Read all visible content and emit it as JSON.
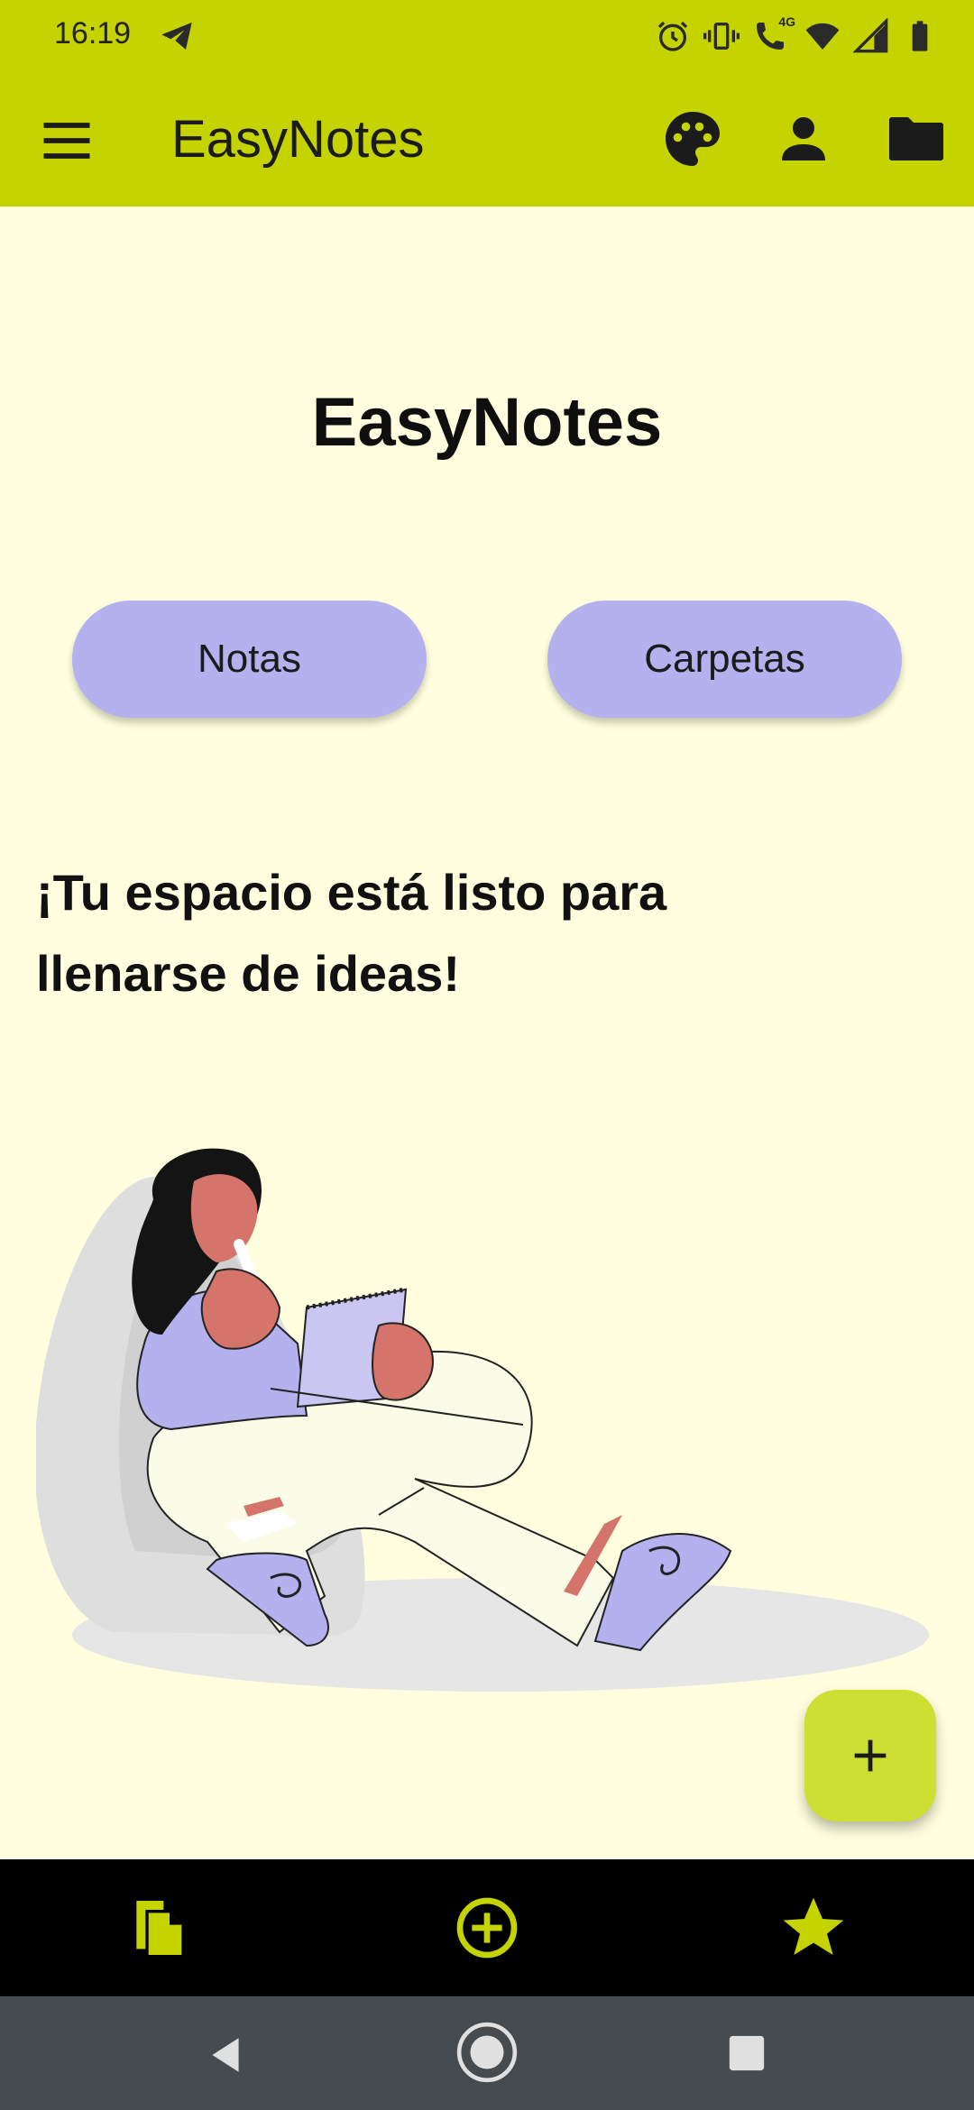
{
  "status_bar": {
    "time": "16:19",
    "icons": [
      "telegram-icon",
      "alarm-icon",
      "vibrate-icon",
      "volte-call-icon",
      "wifi-icon",
      "signal-icon",
      "battery-icon"
    ],
    "network_label": "4G"
  },
  "app_bar": {
    "title": "EasyNotes",
    "icons": [
      "menu-icon",
      "palette-icon",
      "person-icon",
      "folder-icon"
    ],
    "color": "#C5D400"
  },
  "main": {
    "title": "EasyNotes",
    "buttons": {
      "notes": "Notas",
      "folders": "Carpetas"
    },
    "headline": "¡Tu espacio está listo para llenarse de ideas!",
    "illustration": "woman-reading-notebook-illustration"
  },
  "fab": {
    "icon": "plus-icon",
    "color": "#CEDF34"
  },
  "bottom_nav": {
    "items": [
      "notes-icon",
      "add-circle-icon",
      "star-icon"
    ],
    "icon_color": "#C5D400"
  },
  "system_nav": {
    "items": [
      "back-icon",
      "home-icon",
      "recents-icon"
    ]
  },
  "colors": {
    "background": "#FFFFDF",
    "pill": "#B5B0EE",
    "bottom_nav_bg": "#000000",
    "system_nav_bg": "#464B50"
  }
}
